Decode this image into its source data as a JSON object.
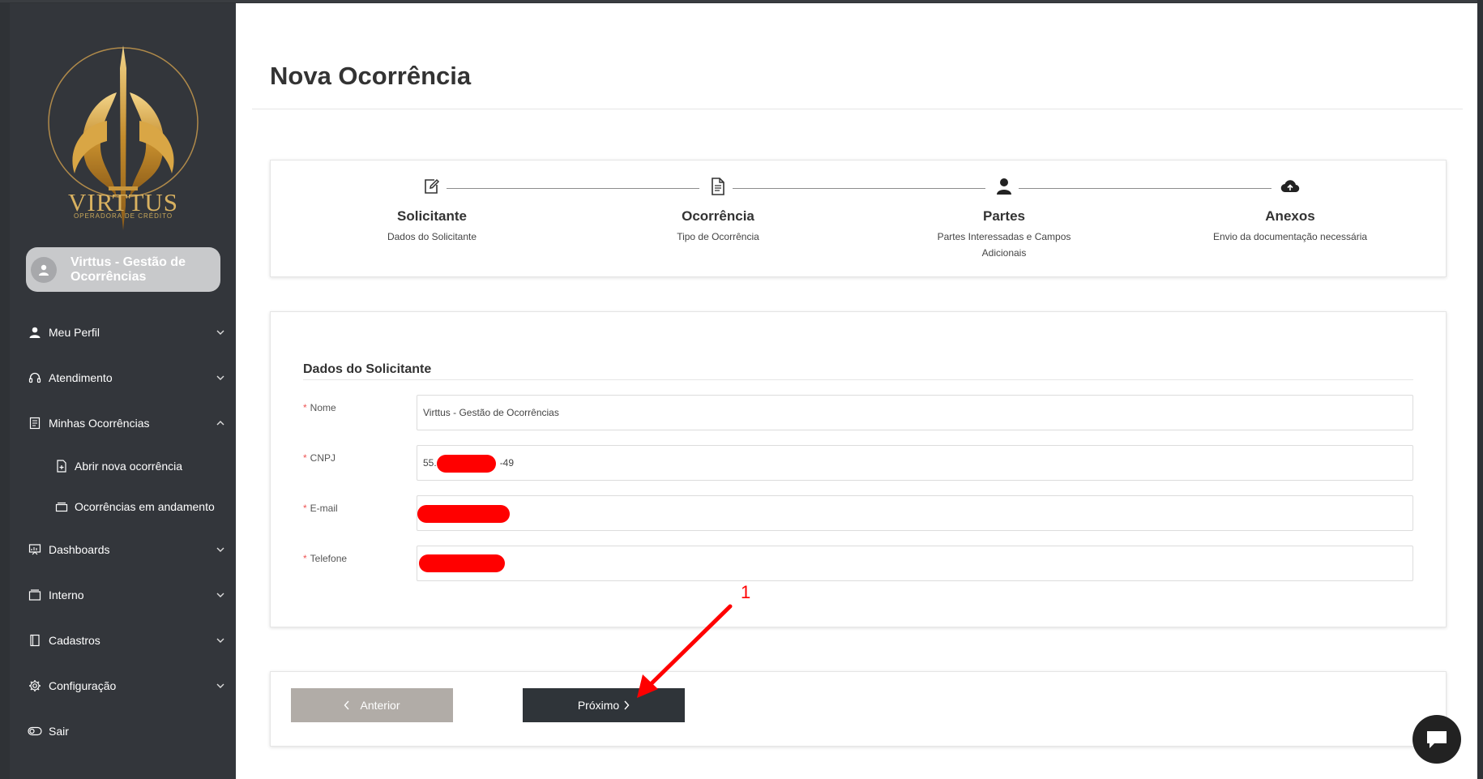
{
  "sidebar": {
    "logo": {
      "brand": "VIRTTUS",
      "tagline": "OPERADORA DE CRÉDITO"
    },
    "user": {
      "name": "Virttus - Gestão de Ocorrências"
    },
    "menu": [
      {
        "label": "Meu Perfil",
        "icon": "user-icon"
      },
      {
        "label": "Atendimento",
        "icon": "headset-icon"
      },
      {
        "label": "Minhas Ocorrências",
        "icon": "document-list-icon"
      },
      {
        "label": "Dashboards",
        "icon": "presentation-chart-icon"
      },
      {
        "label": "Interno",
        "icon": "inbox-icon"
      },
      {
        "label": "Cadastros",
        "icon": "book-icon"
      },
      {
        "label": "Configuração",
        "icon": "gear-icon"
      },
      {
        "label": "Sair",
        "icon": "toggle-icon"
      }
    ],
    "submenu": [
      {
        "label": "Abrir nova ocorrência",
        "icon": "file-plus-icon"
      },
      {
        "label": "Ocorrências em andamento",
        "icon": "folder-stack-icon"
      }
    ]
  },
  "page": {
    "title": "Nova Ocorrência"
  },
  "steps": [
    {
      "title": "Solicitante",
      "desc": "Dados do Solicitante",
      "icon": "edit-icon"
    },
    {
      "title": "Ocorrência",
      "desc": "Tipo de Ocorrência",
      "icon": "document-icon"
    },
    {
      "title": "Partes",
      "desc": "Partes Interessadas e Campos Adicionais",
      "icon": "person-icon"
    },
    {
      "title": "Anexos",
      "desc": "Envio da documentação necessária",
      "icon": "cloud-upload-icon"
    }
  ],
  "form": {
    "section_title": "Dados do Solicitante",
    "fields": [
      {
        "label": "Nome",
        "value": "Virttus - Gestão de Ocorrências"
      },
      {
        "label": "CNPJ",
        "value_prefix": "55.",
        "value_suffix": "-49"
      },
      {
        "label": "E-mail",
        "value": ""
      },
      {
        "label": "Telefone",
        "value": ""
      }
    ]
  },
  "buttons": {
    "prev": "Anterior",
    "next": "Próximo"
  },
  "annotation": {
    "number": "1",
    "color": "#ff0000"
  },
  "colors": {
    "sidebar": "#33363b",
    "primary_button": "#2f3439",
    "secondary_button": "#b1aca7",
    "accent_gold": "#d8b160"
  }
}
